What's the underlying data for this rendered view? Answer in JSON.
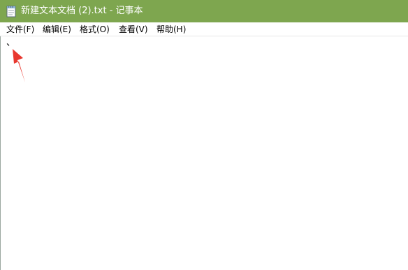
{
  "window": {
    "title": "新建文本文档 (2).txt - 记事本",
    "icon": "notepad-icon",
    "titlebar_color": "#7ea64f"
  },
  "menu": {
    "items": [
      {
        "label": "文件(F)"
      },
      {
        "label": "编辑(E)"
      },
      {
        "label": "格式(O)"
      },
      {
        "label": "查看(V)"
      },
      {
        "label": "帮助(H)"
      }
    ]
  },
  "editor": {
    "content": "、"
  },
  "annotation": {
    "icon": "red-arrow-icon",
    "color": "#e8382f"
  }
}
